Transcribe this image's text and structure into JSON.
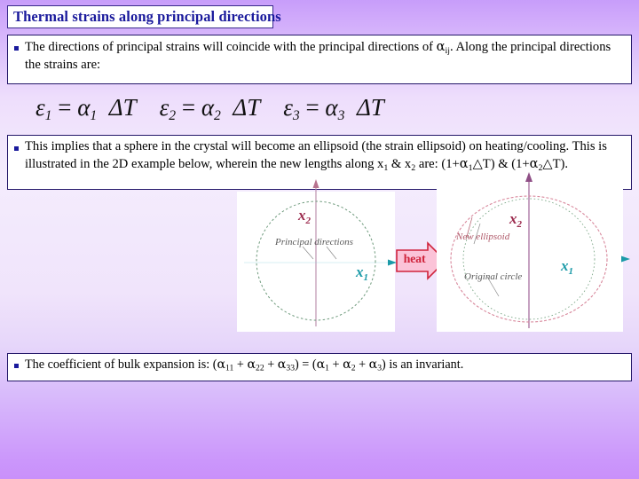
{
  "slide": {
    "title": "Thermal strains along principal directions",
    "background": {
      "top_color": "#c79dfa",
      "mid_color": "#f4ecfd",
      "bottom_color": "#c990fa"
    },
    "title_color": "#1a1a9c",
    "border_color": "#231769"
  },
  "bullets": {
    "first": {
      "marker": "§",
      "line1": "The directions of principal strains will coincide with the principal directions of αij. Along the",
      "line2": "principal directions the strains are:",
      "text_plain": "The directions of principal strains will coincide with the principal directions of αij. Along the principal directions the strains are:"
    },
    "second": {
      "marker": "§",
      "line1": "This implies that a sphere in the crystal will become an ellipsoid (the strain ellipsoid) on",
      "line2": "heating/cooling. This is illustrated in the 2D example below, wherein the new lengths along x1",
      "line3": "& x2 are: (1+α1△T) & (1+α2△T).",
      "text_plain": "This implies that a sphere in the crystal will become an ellipsoid (the strain ellipsoid) on heating/cooling. This is illustrated in the 2D example below, wherein the new lengths along x1 & x2 are: (1+α1△T) & (1+α2△T)."
    },
    "third": {
      "marker": "§",
      "text_plain": "The coefficient of bulk expansion is: (α11 + α22 + α33) = (α1 + α2 + α3) is an invariant."
    }
  },
  "equations": [
    {
      "id": "eq1",
      "lhs": "ε",
      "lhs_sub": "1",
      "rhs_coef": "α",
      "rhs_sub": "1",
      "rhs_term": "ΔT",
      "full": "ε1 = α1 ΔT"
    },
    {
      "id": "eq2",
      "lhs": "ε",
      "lhs_sub": "2",
      "rhs_coef": "α",
      "rhs_sub": "2",
      "rhs_term": "ΔT",
      "full": "ε2 = α2 ΔT"
    },
    {
      "id": "eq3",
      "lhs": "ε",
      "lhs_sub": "3",
      "rhs_coef": "α",
      "rhs_sub": "3",
      "rhs_term": "ΔT",
      "full": "ε3 = α3 ΔT"
    }
  ],
  "figures": {
    "left": {
      "caption": "Principal directions",
      "axis_x2": "x",
      "axis_x2_sub": "2",
      "axis_x1": "x",
      "axis_x1_sub": "1",
      "shape": "circle",
      "circle_color": "#6e9a7c",
      "x2_color": "#9c2b4e",
      "x1_color": "#1b9aa8"
    },
    "right": {
      "label_new": "New ellipsoid",
      "label_original": "Original circle",
      "axis_x2": "x",
      "axis_x2_sub": "2",
      "axis_x1": "x",
      "axis_x1_sub": "1",
      "ellipse_color": "#d8889c",
      "circle_color": "#6e9a7c"
    }
  },
  "heat_arrow": {
    "label": "heat",
    "fill": "#fbc3d8",
    "stroke": "#d0243c",
    "text_color": "#d0243c"
  }
}
